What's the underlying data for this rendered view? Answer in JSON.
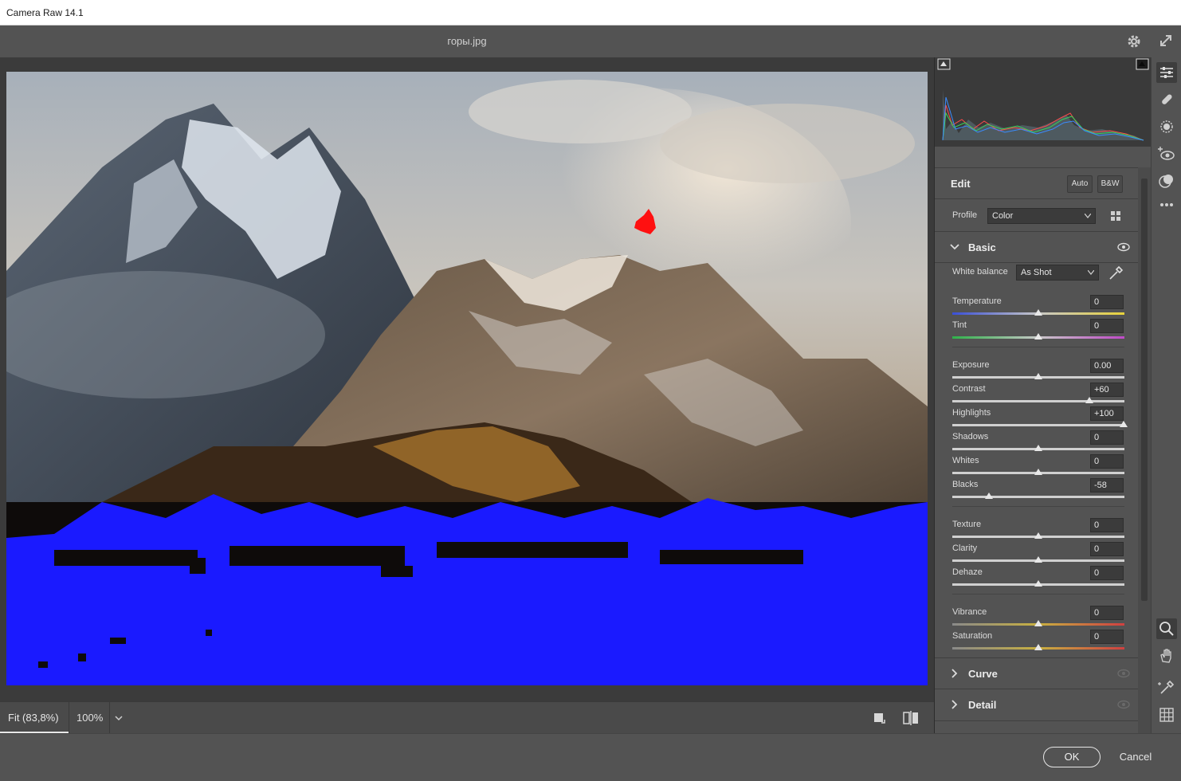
{
  "window": {
    "title": "Camera Raw 14.1"
  },
  "topbar": {
    "filename": "горы.jpg",
    "settings_icon": "gear-icon",
    "fullscreen_icon": "expand-icon"
  },
  "zoom": {
    "fit_label": "Fit (83,8%)",
    "percent_label": "100%"
  },
  "footer": {
    "ok_label": "OK",
    "cancel_label": "Cancel"
  },
  "edit": {
    "title": "Edit",
    "auto_label": "Auto",
    "bw_label": "B&W"
  },
  "profile": {
    "label": "Profile",
    "value": "Color"
  },
  "basic": {
    "title": "Basic",
    "white_balance_label": "White balance",
    "white_balance_value": "As Shot",
    "sliders": [
      {
        "name": "Temperature",
        "value": "0",
        "level": 0.5,
        "track": "temperature"
      },
      {
        "name": "Tint",
        "value": "0",
        "level": 0.5,
        "track": "tint"
      },
      {
        "name": "Exposure",
        "value": "0.00",
        "level": 0.5,
        "track": "gray"
      },
      {
        "name": "Contrast",
        "value": "+60",
        "level": 0.8,
        "track": "gray"
      },
      {
        "name": "Highlights",
        "value": "+100",
        "level": 1.0,
        "track": "gray"
      },
      {
        "name": "Shadows",
        "value": "0",
        "level": 0.5,
        "track": "gray"
      },
      {
        "name": "Whites",
        "value": "0",
        "level": 0.5,
        "track": "gray"
      },
      {
        "name": "Blacks",
        "value": "-58",
        "level": 0.21,
        "track": "gray"
      },
      {
        "name": "Texture",
        "value": "0",
        "level": 0.5,
        "track": "gray"
      },
      {
        "name": "Clarity",
        "value": "0",
        "level": 0.5,
        "track": "gray"
      },
      {
        "name": "Dehaze",
        "value": "0",
        "level": 0.5,
        "track": "gray"
      },
      {
        "name": "Vibrance",
        "value": "0",
        "level": 0.5,
        "track": "vivid"
      },
      {
        "name": "Saturation",
        "value": "0",
        "level": 0.5,
        "track": "vivid"
      }
    ]
  },
  "sections": [
    {
      "title": "Curve"
    },
    {
      "title": "Detail"
    }
  ],
  "tools": [
    "edit-sliders-icon",
    "healing-brush-icon",
    "masking-icon",
    "red-eye-icon",
    "presets-icon",
    "more-icon",
    "zoom-icon",
    "hand-icon",
    "color-sampler-icon",
    "grid-icon"
  ],
  "colors": {
    "accent_clip_shadow": "#1a1aff",
    "accent_clip_highlight": "#ff1010",
    "panel_bg": "#535353"
  }
}
